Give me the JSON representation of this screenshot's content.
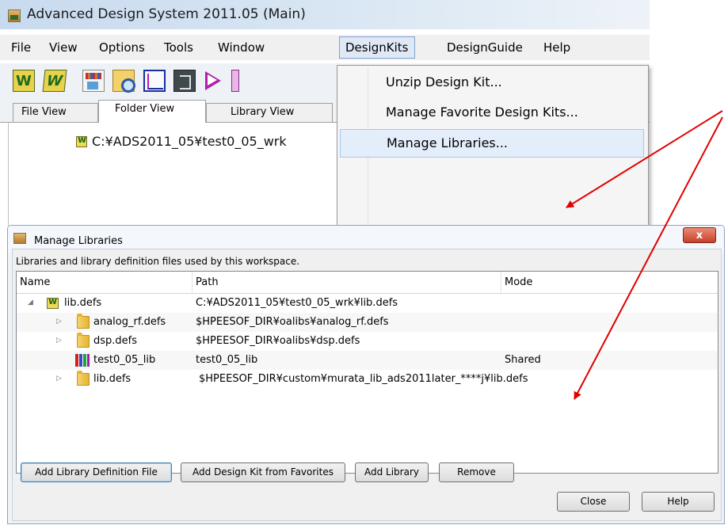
{
  "main_window": {
    "title": "Advanced Design System 2011.05 (Main)",
    "menu": [
      "File",
      "View",
      "Options",
      "Tools",
      "Window",
      "DesignKits",
      "DesignGuide",
      "Help"
    ],
    "toolbar_icons": [
      "new-workspace-icon",
      "open-workspace-icon",
      "library-icon",
      "search-icon",
      "schematic-icon",
      "layout-icon",
      "symbol-icon"
    ],
    "tabs": [
      "File View",
      "Folder View",
      "Library View"
    ],
    "active_tab": "Folder View",
    "workspace_path": "C:¥ADS2011_05¥test0_05_wrk"
  },
  "designkits_menu": {
    "items": [
      "Unzip Design Kit...",
      "Manage Favorite Design Kits...",
      "Manage Libraries..."
    ],
    "highlighted": "Manage Libraries..."
  },
  "dialog": {
    "title": "Manage Libraries",
    "close_label": "x",
    "description": "Libraries and library definition files used by this workspace.",
    "columns": [
      "Name",
      "Path",
      "Mode"
    ],
    "rows": [
      {
        "name": "lib.defs",
        "path": "C:¥ADS2011_05¥test0_05_wrk¥lib.defs",
        "mode": ""
      },
      {
        "name": "analog_rf.defs",
        "path": "$HPEESOF_DIR¥oalibs¥analog_rf.defs",
        "mode": ""
      },
      {
        "name": "dsp.defs",
        "path": "$HPEESOF_DIR¥oalibs¥dsp.defs",
        "mode": ""
      },
      {
        "name": "test0_05_lib",
        "path": "test0_05_lib",
        "mode": "Shared"
      },
      {
        "name": "lib.defs",
        "path": "$HPEESOF_DIR¥custom¥murata_lib_ads2011later_****j¥lib.defs",
        "mode": ""
      }
    ],
    "buttons": {
      "add_definition_file": "Add Library Definition File",
      "add_design_kit": "Add Design Kit from Favorites",
      "add_library": "Add Library",
      "remove": "Remove",
      "close": "Close",
      "help": "Help"
    }
  },
  "colors": {
    "annotation_arrow": "#e00000",
    "menu_highlight": "#e3eefa",
    "window_frame": "#8ea4bd"
  }
}
